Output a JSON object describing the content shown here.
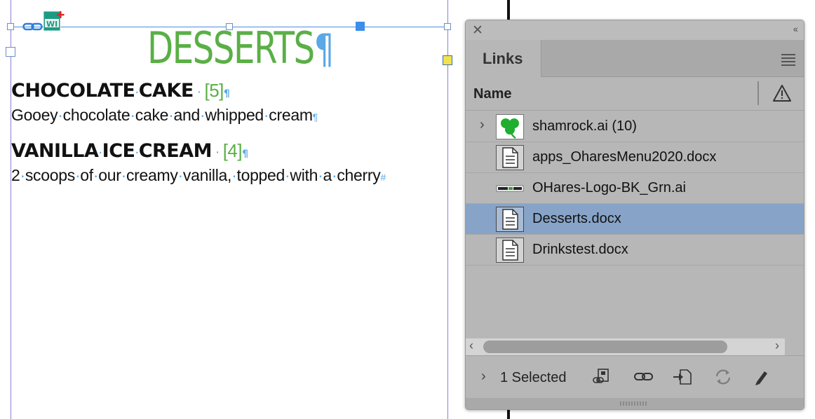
{
  "document": {
    "title": "DESSERTS",
    "pilcrow": "¶",
    "items": [
      {
        "name_words": [
          "CHOCOLATE",
          "CAKE"
        ],
        "number": "[5]",
        "description_words": [
          "Gooey",
          "chocolate",
          "cake",
          "and",
          "whipped",
          "cream"
        ],
        "end_mark": "¶"
      },
      {
        "name_words": [
          "VANILLA",
          "ICE",
          "CREAM"
        ],
        "number": "[4]",
        "description_words": [
          "2",
          "scoops",
          "of",
          "our",
          "creamy",
          "vanilla,",
          "topped",
          "with",
          "a",
          "cherry"
        ],
        "end_mark": "#"
      }
    ]
  },
  "panel": {
    "close_glyph": "✕",
    "collapse_glyph": "‹‹",
    "tab_label": "Links",
    "column_name": "Name",
    "rows": [
      {
        "name": "shamrock.ai (10)",
        "thumb": "shamrock-icon",
        "expandable": true,
        "selected": false
      },
      {
        "name": "apps_OharesMenu2020.docx",
        "thumb": "document-icon",
        "expandable": false,
        "selected": false
      },
      {
        "name": "OHares-Logo-BK_Grn.ai",
        "thumb": "logo-thumb-icon",
        "expandable": false,
        "selected": false
      },
      {
        "name": "Desserts.docx",
        "thumb": "document-icon",
        "expandable": false,
        "selected": true
      },
      {
        "name": "Drinkstest.docx",
        "thumb": "document-icon",
        "expandable": false,
        "selected": false
      }
    ],
    "footer": {
      "selection_text": "1 Selected"
    },
    "colors": {
      "accent": "#5aaf46",
      "selected_row": "#87a4c8",
      "panel_bg": "#b7b7b7"
    }
  }
}
